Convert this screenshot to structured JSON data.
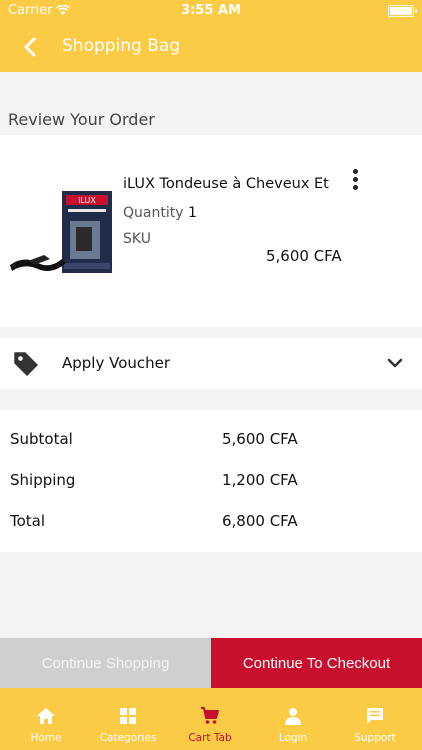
{
  "status_bar": {
    "carrier": "Carrier",
    "time": "3:55 AM"
  },
  "nav": {
    "title": "Shopping Bag"
  },
  "review": {
    "heading": "Review Your Order"
  },
  "product": {
    "name": "iLUX Tondeuse à Cheveux Et",
    "quantity_label": "Quantity",
    "quantity": "1",
    "sku_label": "SKU",
    "price": "5,600 CFA",
    "image_brand": "iLUX"
  },
  "voucher": {
    "label": "Apply Voucher"
  },
  "summary": {
    "rows": [
      {
        "label": "Subtotal",
        "value": "5,600 CFA"
      },
      {
        "label": "Shipping",
        "value": "1,200 CFA"
      },
      {
        "label": "Total",
        "value": "6,800 CFA"
      }
    ]
  },
  "actions": {
    "continue_shopping": "Continue Shopping",
    "checkout": "Continue To Checkout"
  },
  "tabs": [
    {
      "label": "Home",
      "icon": "home-icon"
    },
    {
      "label": "Categories",
      "icon": "grid-icon"
    },
    {
      "label": "Cart Tab",
      "icon": "cart-icon",
      "active": true
    },
    {
      "label": "Login",
      "icon": "user-icon"
    },
    {
      "label": "Support",
      "icon": "chat-icon"
    }
  ],
  "colors": {
    "brand_yellow": "#fccb45",
    "accent_red": "#c8102e",
    "disabled_gray": "#cfcfcf"
  }
}
